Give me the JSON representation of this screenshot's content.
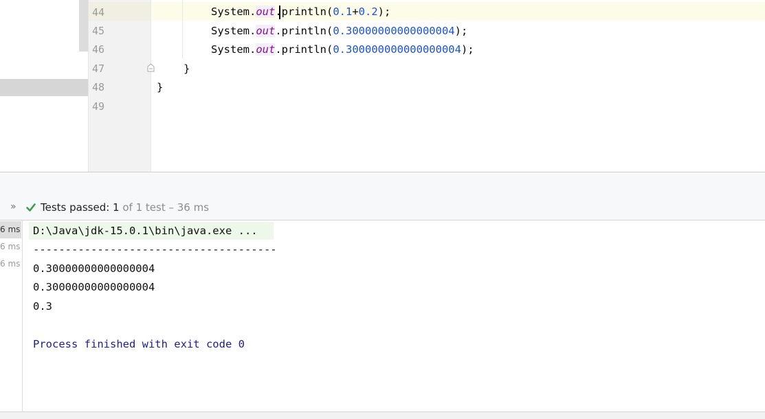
{
  "editor": {
    "line_numbers": [
      "44",
      "45",
      "46",
      "47",
      "48",
      "49"
    ],
    "lines": [
      {
        "prefix": "System.",
        "field": "out",
        "mid": ".println(",
        "arg1": "0.1",
        "op": "+",
        "arg2": "0.2",
        "suffix": ");"
      },
      {
        "prefix": "System.",
        "field": "out",
        "mid": ".println(",
        "arg1": "0.30000000000000004",
        "suffix": ");"
      },
      {
        "prefix": "System.",
        "field": "out",
        "mid": ".println(",
        "arg1": "0.300000000000000004",
        "suffix": ");"
      },
      {
        "text": "}"
      },
      {
        "text": "}"
      }
    ]
  },
  "test_toolbar": {
    "expand_icon": "»",
    "check_icon": "green-checkmark",
    "status_label": "Tests passed: ",
    "passed": "1",
    "of_text": " of 1 test – 36 ms"
  },
  "tree": {
    "times": [
      "6 ms",
      "6 ms",
      "6 ms"
    ]
  },
  "console": {
    "command": "D:\\Java\\jdk-15.0.1\\bin\\java.exe ...",
    "separator": "--------------------------------------",
    "outputs": [
      "0.30000000000000004",
      "0.30000000000000004",
      "0.3"
    ],
    "exit": "Process finished with exit code 0"
  },
  "colors": {
    "number": "#1750eb",
    "field": "#871094",
    "exit_text": "#1c1c96",
    "check": "#3d9a50"
  }
}
